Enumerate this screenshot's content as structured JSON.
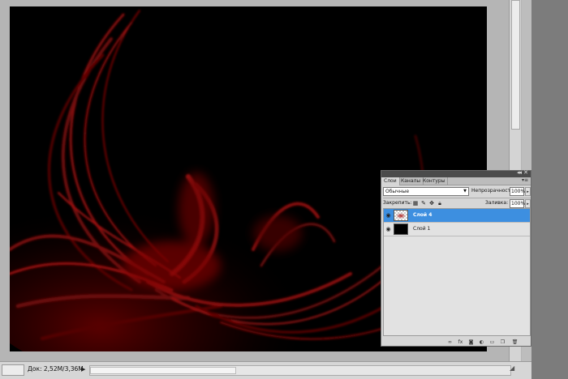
{
  "status": {
    "zoom": "",
    "doc_size": "Док: 2,52M/3,36M",
    "arrow_icon": "triangle-right-icon"
  },
  "layers_panel": {
    "tabs": [
      {
        "label": "Слои",
        "active": true
      },
      {
        "label": "Каналы",
        "active": false
      },
      {
        "label": "Контуры",
        "active": false
      }
    ],
    "blend_mode": "Обычные",
    "opacity_label": "Непрозрачность:",
    "opacity_value": "100%",
    "lock_label": "Закрепить:",
    "fill_label": "Заливка:",
    "fill_value": "100%",
    "layers": [
      {
        "name": "Слой 4",
        "selected": true,
        "visible": true,
        "thumb": "transparent-red"
      },
      {
        "name": "Слой 1",
        "selected": false,
        "visible": true,
        "thumb": "black"
      }
    ],
    "footer_icons": [
      "link-icon",
      "fx-icon",
      "mask-icon",
      "adjustment-icon",
      "folder-icon",
      "new-layer-icon",
      "trash-icon"
    ]
  },
  "colors": {
    "selection": "#3d8fe0",
    "canvas_bg": "#000000",
    "swirl": "#b01010"
  }
}
